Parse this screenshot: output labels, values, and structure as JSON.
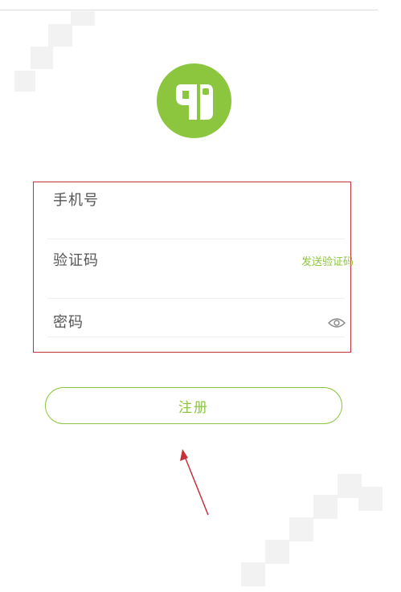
{
  "form": {
    "phone_label": "手机号",
    "code_label": "验证码",
    "send_code_label": "发送验证码",
    "password_label": "密码"
  },
  "register": {
    "label": "注册"
  },
  "icons": {
    "logo": "app-logo-icon",
    "eye": "eye-icon"
  },
  "colors": {
    "accent": "#8cc63f",
    "highlight_border": "#c7323a",
    "arrow": "#c7323a"
  }
}
